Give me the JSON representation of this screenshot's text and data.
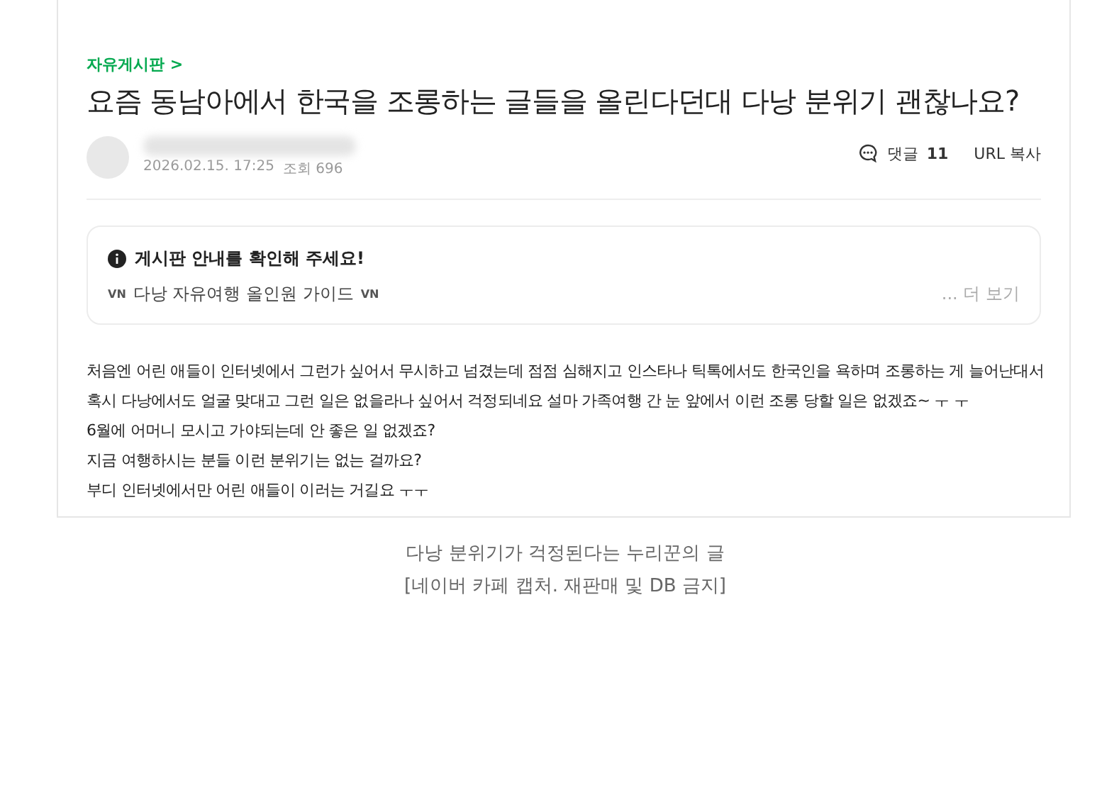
{
  "post": {
    "board": "자유게시판 >",
    "title": "요즘 동남아에서 한국을 조롱하는 글들을 올린다던대 다낭 분위기 괜찮나요?",
    "date": "2026.02.15. 17:25",
    "views": "조회 696",
    "comments_label": "댓글",
    "comments_count": "11",
    "url_copy": "URL 복사"
  },
  "notice": {
    "heading": "게시판 안내를 확인해 주세요!",
    "prefix": "VN",
    "link": "다낭 자유여행 올인원 가이드",
    "suffix": "VN",
    "more": "... 더 보기"
  },
  "body": [
    "처음엔 어린 애들이 인터넷에서 그런가 싶어서 무시하고 넘겼는데 점점 심해지고 인스타나 틱톡에서도 한국인을 욕하며 조롱하는 게 늘어난대서",
    "혹시 다낭에서도 얼굴 맞대고 그런 일은 없을라나 싶어서 걱정되네요 설마 가족여행 간 눈 앞에서 이런 조롱 당할 일은 없겠죠~ ㅜ ㅜ",
    "6월에 어머니 모시고 가야되는데 안 좋은 일 없겠죠?",
    "지금 여행하시는 분들 이런 분위기는 없는 걸까요?",
    "부디 인터넷에서만 어린 애들이 이러는 거길요 ㅜㅜ"
  ],
  "caption": [
    "다낭 분위기가 걱정된다는 누리꾼의 글",
    "[네이버 카페 캡처. 재판매 및 DB 금지]"
  ]
}
